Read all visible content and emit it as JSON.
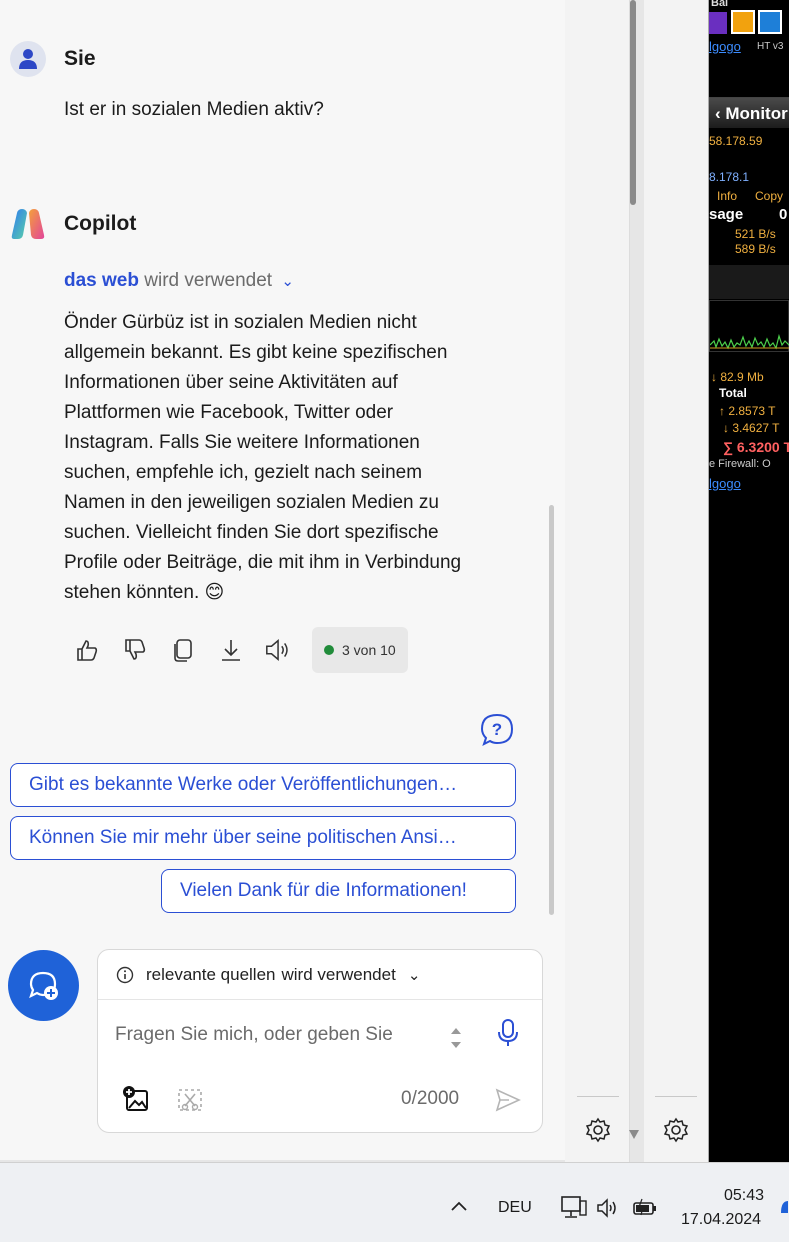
{
  "conversation": {
    "user": {
      "name": "Sie",
      "message": "Ist er in sozialen Medien aktiv?"
    },
    "copilot": {
      "name": "Copilot",
      "source_prefix": "das web",
      "source_suffix": "wird verwendet",
      "answer_lines": [
        "Önder Gürbüz ist in sozialen Medien nicht",
        "allgemein bekannt. Es gibt keine spezifischen",
        "Informationen über seine Aktivitäten auf",
        "Plattformen wie Facebook, Twitter oder",
        "Instagram. Falls Sie weitere Informationen",
        "suchen, empfehle ich, gezielt nach seinem",
        "Namen in den jeweiligen sozialen Medien zu",
        "suchen. Vielleicht finden Sie dort spezifische",
        "Profile oder Beiträge, die mit ihm in Verbindung",
        "stehen könnten. 😊"
      ],
      "response_counter": "3 von 10"
    }
  },
  "suggestions": [
    "Gibt es bekannte Werke oder Veröffentlichungen…",
    "Können Sie mir mehr über seine politischen Ansi…",
    "Vielen Dank für die Informationen!"
  ],
  "composer": {
    "source_label": "relevante quellen",
    "source_suffix": "wird verwendet",
    "placeholder": "Fragen Sie mich, oder geben Sie",
    "char_count": "0/2000"
  },
  "monitor": {
    "title": "‹ Monitor",
    "ip1": "58.178.59",
    "ip2": "8.178.1",
    "info": "Info",
    "copy": "Copy",
    "usage": "sage",
    "usage_val": "0",
    "rate1": "521 B/s",
    "rate2": "589 B/s",
    "down_rate": "↓ 82.9 Mb",
    "total": "Total",
    "up_total": "↑ 2.8573 T",
    "down_total": "↓ 3.4627 T",
    "sum_total": "∑ 6.3200 T",
    "firewall": "e  Firewall: O",
    "link": "lgogo",
    "top_label": "Bal",
    "top_link": "lgogo",
    "top_ht": "HT v3"
  },
  "taskbar": {
    "language": "DEU",
    "time": "05:43",
    "date": "17.04.2024"
  }
}
